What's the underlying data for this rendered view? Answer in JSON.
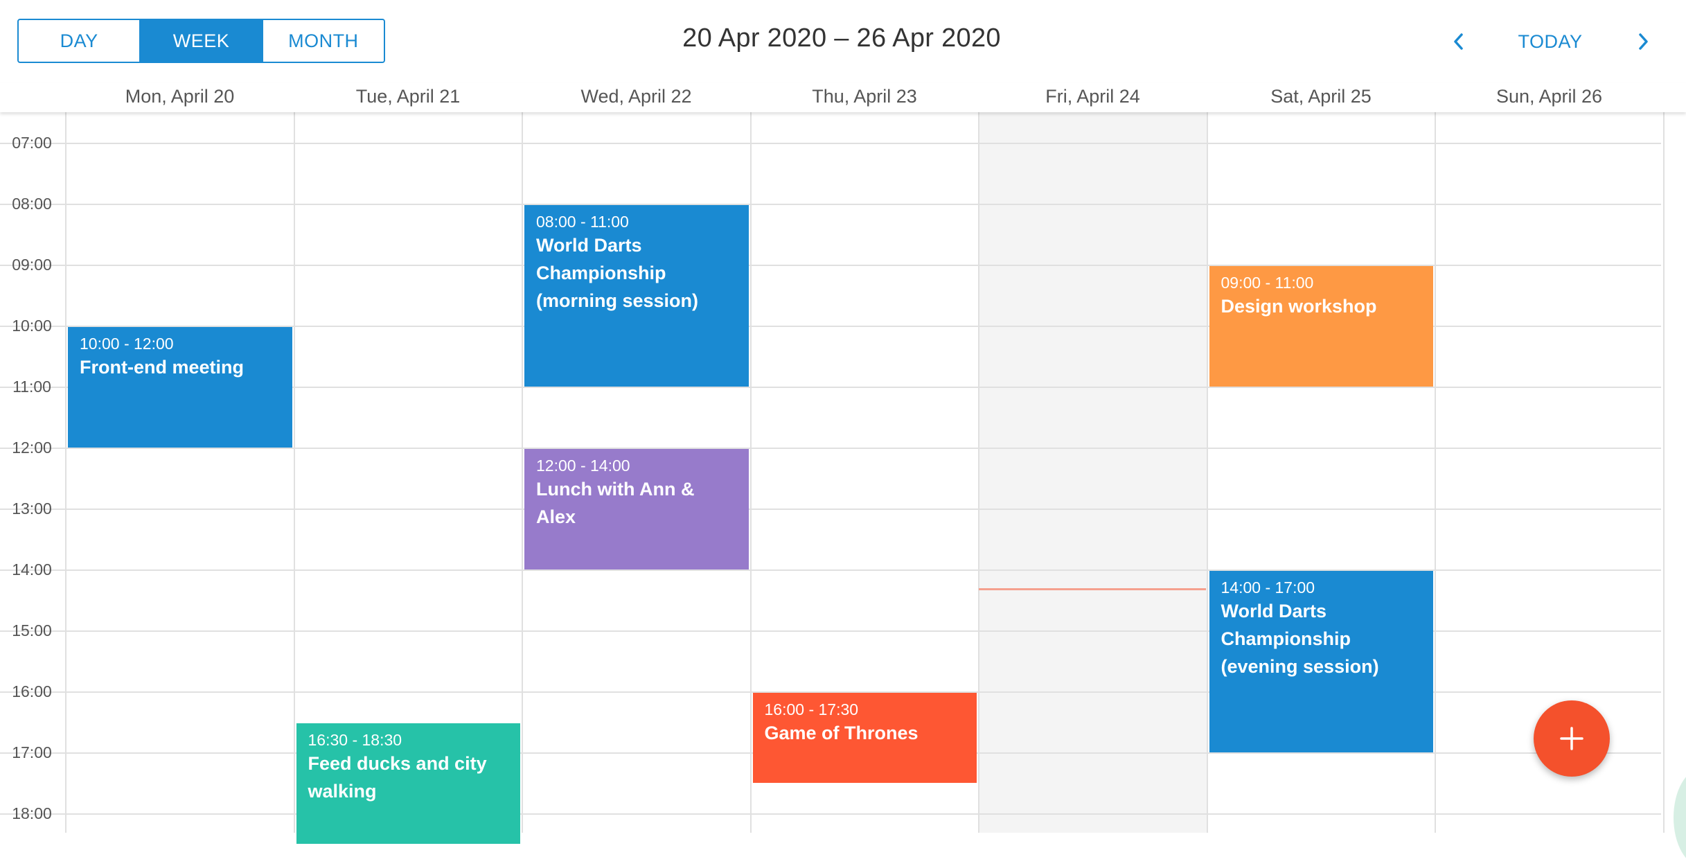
{
  "toolbar": {
    "views": [
      "DAY",
      "WEEK",
      "MONTH"
    ],
    "active_view": "WEEK",
    "date_range": "20 Apr 2020 – 26 Apr 2020",
    "today_label": "TODAY",
    "prev_icon": "chevron-left-icon",
    "next_icon": "chevron-right-icon"
  },
  "days": [
    "Mon, April 20",
    "Tue, April 21",
    "Wed, April 22",
    "Thu, April 23",
    "Fri, April 24",
    "Sat, April 25",
    "Sun, April 26"
  ],
  "times": [
    "07:00",
    "08:00",
    "09:00",
    "10:00",
    "11:00",
    "12:00",
    "13:00",
    "14:00",
    "15:00",
    "16:00",
    "17:00",
    "18:00"
  ],
  "today_index": 4,
  "now_time": "14:18",
  "events": [
    {
      "day": 0,
      "start": "10:00",
      "end": "12:00",
      "time": "10:00 - 12:00",
      "title": "Front-end meeting",
      "color": "#1a8ad2"
    },
    {
      "day": 1,
      "start": "16:30",
      "end": "18:30",
      "time": "16:30 - 18:30",
      "title": "Feed ducks and city walking",
      "color": "#26c2a8"
    },
    {
      "day": 2,
      "start": "08:00",
      "end": "11:00",
      "time": "08:00 - 11:00",
      "title": "World Darts Championship (morning session)",
      "color": "#1a8ad2"
    },
    {
      "day": 2,
      "start": "12:00",
      "end": "14:00",
      "time": "12:00 - 14:00",
      "title": "Lunch with Ann & Alex",
      "color": "#977bcb"
    },
    {
      "day": 3,
      "start": "16:00",
      "end": "17:30",
      "time": "16:00 - 17:30",
      "title": "Game of Thrones",
      "color": "#fe5733"
    },
    {
      "day": 5,
      "start": "09:00",
      "end": "11:00",
      "time": "09:00 - 11:00",
      "title": "Design workshop",
      "color": "#fe9944"
    },
    {
      "day": 5,
      "start": "14:00",
      "end": "17:00",
      "time": "14:00 - 17:00",
      "title": "World Darts Championship (evening session)",
      "color": "#1a8ad2"
    }
  ],
  "fab": {
    "icon": "plus-icon",
    "color": "#f4512c"
  },
  "colors": {
    "accent": "#1a8ad2",
    "now_line": "#f5a08e",
    "today_shade": "#f4f4f4"
  }
}
